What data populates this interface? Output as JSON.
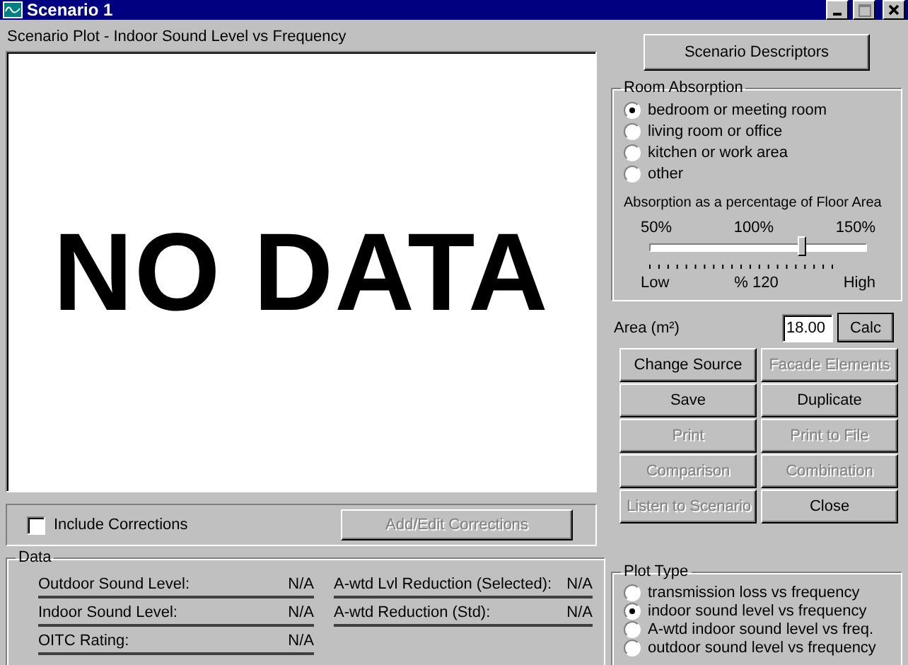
{
  "window": {
    "title": "Scenario 1"
  },
  "plot": {
    "title": "Scenario Plot - Indoor Sound Level vs Frequency",
    "message": "NO DATA"
  },
  "corrections": {
    "label": "Include Corrections",
    "checked": false,
    "button": {
      "label": "Add/Edit Corrections",
      "disabled": true
    }
  },
  "data": {
    "title": "Data",
    "left": [
      {
        "label": "Outdoor Sound Level:",
        "value": "N/A"
      },
      {
        "label": "Indoor Sound Level:",
        "value": "N/A"
      },
      {
        "label": "OITC Rating:",
        "value": "N/A"
      }
    ],
    "right": [
      {
        "label": "A-wtd Lvl Reduction (Selected):",
        "value": "N/A"
      },
      {
        "label": "A-wtd Reduction (Std):",
        "value": "N/A"
      }
    ]
  },
  "descriptors_button": "Scenario Descriptors",
  "room_absorption": {
    "title": "Room Absorption",
    "options": [
      {
        "label": "bedroom or meeting room",
        "selected": true
      },
      {
        "label": "living room or office",
        "selected": false
      },
      {
        "label": "kitchen or work area",
        "selected": false
      },
      {
        "label": "other",
        "selected": false
      }
    ],
    "slider_title": "Absorption as a percentage of Floor Area",
    "top_labels": [
      "50%",
      "100%",
      "150%"
    ],
    "level": 0.7,
    "bottom_labels": [
      "Low",
      "% 120",
      "High"
    ]
  },
  "area": {
    "label": "Area (m²)",
    "value": "18.00",
    "button": "Calc"
  },
  "buttons": [
    {
      "label": "Change Source",
      "disabled": false
    },
    {
      "label": "Facade Elements",
      "disabled": true
    },
    {
      "label": "Save",
      "disabled": false
    },
    {
      "label": "Duplicate",
      "disabled": false
    },
    {
      "label": "Print",
      "disabled": true
    },
    {
      "label": "Print to File",
      "disabled": true
    },
    {
      "label": "Comparison",
      "disabled": true
    },
    {
      "label": "Combination",
      "disabled": true
    },
    {
      "label": "Listen to Scenario",
      "disabled": true
    },
    {
      "label": "Close",
      "disabled": false
    }
  ],
  "plot_type": {
    "title": "Plot Type",
    "options": [
      {
        "label": "transmission loss vs frequency",
        "selected": false
      },
      {
        "label": "indoor sound level vs frequency",
        "selected": true
      },
      {
        "label": "A-wtd indoor sound level vs freq.",
        "selected": false
      },
      {
        "label": "outdoor sound level vs frequency",
        "selected": false
      }
    ]
  }
}
